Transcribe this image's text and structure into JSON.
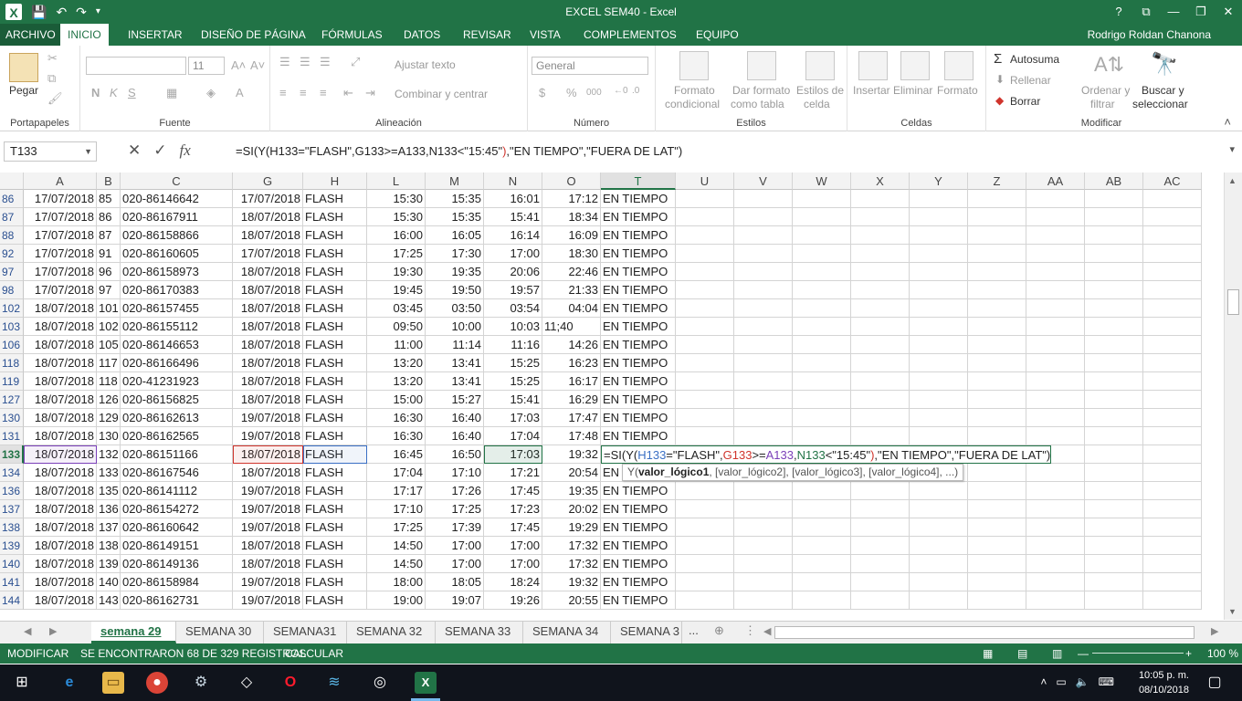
{
  "window": {
    "title": "EXCEL SEM40 - Excel",
    "help": "?",
    "controls": [
      "⧉",
      "—",
      "❐",
      "✕"
    ]
  },
  "ribbon_tabs": {
    "file": "ARCHIVO",
    "items": [
      "INICIO",
      "INSERTAR",
      "DISEÑO DE PÁGINA",
      "FÓRMULAS",
      "DATOS",
      "REVISAR",
      "VISTA",
      "COMPLEMENTOS",
      "EQUIPO"
    ],
    "active": "INICIO",
    "user": "Rodrigo Roldan Chanona"
  },
  "ribbon": {
    "clipboard": {
      "paste": "Pegar",
      "label": "Portapapeles"
    },
    "font": {
      "size": "11",
      "bold": "N",
      "italic": "K",
      "underline": "S",
      "label": "Fuente"
    },
    "alignment": {
      "wrap": "Ajustar texto",
      "merge": "Combinar y centrar",
      "label": "Alineación"
    },
    "number": {
      "format": "General",
      "currency": "$",
      "percent": "%",
      "thousands": "000",
      "label": "Número"
    },
    "styles": {
      "conditional1": "Formato",
      "conditional2": "condicional",
      "table1": "Dar formato",
      "table2": "como tabla",
      "cell1": "Estilos de",
      "cell2": "celda",
      "label": "Estilos"
    },
    "cells": {
      "insert": "Insertar",
      "delete": "Eliminar",
      "format": "Formato",
      "label": "Celdas"
    },
    "editing": {
      "autosum": "Autosuma",
      "fill": "Rellenar",
      "clear": "Borrar",
      "sort1": "Ordenar y",
      "sort2": "filtrar",
      "find1": "Buscar y",
      "find2": "seleccionar",
      "label": "Modificar"
    }
  },
  "formula_bar": {
    "name_box": "T133",
    "fx": "fx",
    "formula_parts": [
      {
        "t": "=SI(Y(",
        "c": "#222"
      },
      {
        "t": "H133",
        "c": "#222"
      },
      {
        "t": "=\"FLASH\",",
        "c": "#222"
      },
      {
        "t": "G133",
        "c": "#222"
      },
      {
        "t": ">=",
        "c": "#222"
      },
      {
        "t": "A133",
        "c": "#222"
      },
      {
        "t": ",",
        "c": "#222"
      },
      {
        "t": "N133",
        "c": "#222"
      },
      {
        "t": "<\"15:45\"",
        "c": "#222"
      },
      {
        "t": ")",
        "c": "#d0342c"
      },
      {
        "t": ",\"EN TIEMPO\",\"FUERA DE LAT\")",
        "c": "#222"
      }
    ]
  },
  "columns": [
    {
      "name": "A",
      "w": 80
    },
    {
      "name": "B",
      "w": 26
    },
    {
      "name": "C",
      "w": 123
    },
    {
      "name": "G",
      "w": 77
    },
    {
      "name": "H",
      "w": 70
    },
    {
      "name": "L",
      "w": 64
    },
    {
      "name": "M",
      "w": 64
    },
    {
      "name": "N",
      "w": 64
    },
    {
      "name": "O",
      "w": 64
    },
    {
      "name": "T",
      "w": 82
    },
    {
      "name": "U",
      "w": 64
    },
    {
      "name": "V",
      "w": 64
    },
    {
      "name": "W",
      "w": 64
    },
    {
      "name": "X",
      "w": 64
    },
    {
      "name": "Y",
      "w": 64
    },
    {
      "name": "Z",
      "w": 64
    },
    {
      "name": "AA",
      "w": 64
    },
    {
      "name": "AB",
      "w": 64
    },
    {
      "name": "AC",
      "w": 64
    }
  ],
  "rows": [
    {
      "n": "86",
      "A": "17/07/2018",
      "B": "85",
      "C": "020-86146642",
      "G": "17/07/2018",
      "H": "FLASH",
      "L": "15:30",
      "M": "15:35",
      "N": "16:01",
      "O": "17:12",
      "T": "EN TIEMPO"
    },
    {
      "n": "87",
      "A": "17/07/2018",
      "B": "86",
      "C": "020-86167911",
      "G": "18/07/2018",
      "H": "FLASH",
      "L": "15:30",
      "M": "15:35",
      "N": "15:41",
      "O": "18:34",
      "T": "EN TIEMPO"
    },
    {
      "n": "88",
      "A": "17/07/2018",
      "B": "87",
      "C": "020-86158866",
      "G": "18/07/2018",
      "H": "FLASH",
      "L": "16:00",
      "M": "16:05",
      "N": "16:14",
      "O": "16:09",
      "T": "EN TIEMPO"
    },
    {
      "n": "92",
      "A": "17/07/2018",
      "B": "91",
      "C": "020-86160605",
      "G": "17/07/2018",
      "H": "FLASH",
      "L": "17:25",
      "M": "17:30",
      "N": "17:00",
      "O": "18:30",
      "T": "EN TIEMPO"
    },
    {
      "n": "97",
      "A": "17/07/2018",
      "B": "96",
      "C": "020-86158973",
      "G": "18/07/2018",
      "H": "FLASH",
      "L": "19:30",
      "M": "19:35",
      "N": "20:06",
      "O": "22:46",
      "T": "EN TIEMPO"
    },
    {
      "n": "98",
      "A": "17/07/2018",
      "B": "97",
      "C": "020-86170383",
      "G": "18/07/2018",
      "H": "FLASH",
      "L": "19:45",
      "M": "19:50",
      "N": "19:57",
      "O": "21:33",
      "T": "EN TIEMPO"
    },
    {
      "n": "102",
      "A": "18/07/2018",
      "B": "101",
      "C": "020-86157455",
      "G": "18/07/2018",
      "H": "FLASH",
      "L": "03:45",
      "M": "03:50",
      "N": "03:54",
      "O": "04:04",
      "T": "EN TIEMPO"
    },
    {
      "n": "103",
      "A": "18/07/2018",
      "B": "102",
      "C": "020-86155112",
      "G": "18/07/2018",
      "H": "FLASH",
      "L": "09:50",
      "M": "10:00",
      "N": "10:03",
      "O": "11;40",
      "Oleft": true,
      "T": "EN TIEMPO"
    },
    {
      "n": "106",
      "A": "18/07/2018",
      "B": "105",
      "C": "020-86146653",
      "G": "18/07/2018",
      "H": "FLASH",
      "L": "11:00",
      "M": "11:14",
      "N": "11:16",
      "O": "14:26",
      "T": "EN TIEMPO"
    },
    {
      "n": "118",
      "A": "18/07/2018",
      "B": "117",
      "C": "020-86166496",
      "G": "18/07/2018",
      "H": "FLASH",
      "L": "13:20",
      "M": "13:41",
      "N": "15:25",
      "O": "16:23",
      "T": "EN TIEMPO"
    },
    {
      "n": "119",
      "A": "18/07/2018",
      "B": "118",
      "C": "020-41231923",
      "G": "18/07/2018",
      "H": "FLASH",
      "L": "13:20",
      "M": "13:41",
      "N": "15:25",
      "O": "16:17",
      "T": "EN TIEMPO"
    },
    {
      "n": "127",
      "A": "18/07/2018",
      "B": "126",
      "C": "020-86156825",
      "G": "18/07/2018",
      "H": "FLASH",
      "L": "15:00",
      "M": "15:27",
      "N": "15:41",
      "O": "16:29",
      "T": "EN TIEMPO"
    },
    {
      "n": "130",
      "A": "18/07/2018",
      "B": "129",
      "C": "020-86162613",
      "G": "19/07/2018",
      "H": "FLASH",
      "L": "16:30",
      "M": "16:40",
      "N": "17:03",
      "O": "17:47",
      "T": "EN TIEMPO"
    },
    {
      "n": "131",
      "A": "18/07/2018",
      "B": "130",
      "C": "020-86162565",
      "G": "19/07/2018",
      "H": "FLASH",
      "L": "16:30",
      "M": "16:40",
      "N": "17:04",
      "O": "17:48",
      "T": "EN TIEMPO"
    },
    {
      "n": "133",
      "A": "18/07/2018",
      "B": "132",
      "C": "020-86151166",
      "G": "18/07/2018",
      "H": "FLASH",
      "L": "16:45",
      "M": "16:50",
      "N": "17:03",
      "O": "19:32",
      "T": "",
      "active": true
    },
    {
      "n": "134",
      "A": "18/07/2018",
      "B": "133",
      "C": "020-86167546",
      "G": "18/07/2018",
      "H": "FLASH",
      "L": "17:04",
      "M": "17:10",
      "N": "17:21",
      "O": "20:54",
      "T": "EN T"
    },
    {
      "n": "136",
      "A": "18/07/2018",
      "B": "135",
      "C": "020-86141112",
      "G": "19/07/2018",
      "H": "FLASH",
      "L": "17:17",
      "M": "17:26",
      "N": "17:45",
      "O": "19:35",
      "T": "EN TIEMPO"
    },
    {
      "n": "137",
      "A": "18/07/2018",
      "B": "136",
      "C": "020-86154272",
      "G": "19/07/2018",
      "H": "FLASH",
      "L": "17:10",
      "M": "17:25",
      "N": "17:23",
      "O": "20:02",
      "T": "EN TIEMPO"
    },
    {
      "n": "138",
      "A": "18/07/2018",
      "B": "137",
      "C": "020-86160642",
      "G": "19/07/2018",
      "H": "FLASH",
      "L": "17:25",
      "M": "17:39",
      "N": "17:45",
      "O": "19:29",
      "T": "EN TIEMPO"
    },
    {
      "n": "139",
      "A": "18/07/2018",
      "B": "138",
      "C": "020-86149151",
      "G": "18/07/2018",
      "H": "FLASH",
      "L": "14:50",
      "M": "17:00",
      "N": "17:00",
      "O": "17:32",
      "T": "EN TIEMPO"
    },
    {
      "n": "140",
      "A": "18/07/2018",
      "B": "139",
      "C": "020-86149136",
      "G": "18/07/2018",
      "H": "FLASH",
      "L": "14:50",
      "M": "17:00",
      "N": "17:00",
      "O": "17:32",
      "T": "EN TIEMPO"
    },
    {
      "n": "141",
      "A": "18/07/2018",
      "B": "140",
      "C": "020-86158984",
      "G": "19/07/2018",
      "H": "FLASH",
      "L": "18:00",
      "M": "18:05",
      "N": "18:24",
      "O": "19:32",
      "T": "EN TIEMPO"
    },
    {
      "n": "144",
      "A": "18/07/2018",
      "B": "143",
      "C": "020-86162731",
      "G": "19/07/2018",
      "H": "FLASH",
      "L": "19:00",
      "M": "19:07",
      "N": "19:26",
      "O": "20:55",
      "T": "EN TIEMPO"
    }
  ],
  "edit_cell": {
    "parts": [
      {
        "t": "=SI(Y(",
        "c": "#222"
      },
      {
        "t": "H133",
        "c": "#3a6fc4"
      },
      {
        "t": "=\"FLASH\",",
        "c": "#222"
      },
      {
        "t": "G133",
        "c": "#d0342c"
      },
      {
        "t": ">=",
        "c": "#222"
      },
      {
        "t": "A133",
        "c": "#7a3fb8"
      },
      {
        "t": ",",
        "c": "#222"
      },
      {
        "t": "N133",
        "c": "#217346"
      },
      {
        "t": "<\"15:45\"",
        "c": "#222"
      },
      {
        "t": ")",
        "c": "#d0342c"
      },
      {
        "t": ",\"EN TIEMPO\",\"FUERA DE LAT\")",
        "c": "#222"
      }
    ]
  },
  "tooltip": {
    "fn": "Y(",
    "arg_bold": "valor_lógico1",
    "rest": ", [valor_lógico2], [valor_lógico3], [valor_lógico4], ...)"
  },
  "sheets": {
    "tabs": [
      "semana 29",
      "SEMANA 30",
      "SEMANA31",
      "SEMANA 32",
      "SEMANA 33",
      "SEMANA 34",
      "SEMANA 3"
    ],
    "active": "semana 29",
    "more": "..."
  },
  "status": {
    "mode": "MODIFICAR",
    "message": "SE ENCONTRARON 68 DE 329 REGISTROS",
    "calc": "CALCULAR",
    "zoom": "100 %"
  },
  "taskbar": {
    "time": "10:05 p. m.",
    "date": "08/10/2018"
  },
  "colors": {
    "accent": "#217346",
    "ref_h": "#3a6fc4",
    "ref_g": "#d0342c",
    "ref_a": "#7a3fb8",
    "ref_n": "#217346"
  }
}
